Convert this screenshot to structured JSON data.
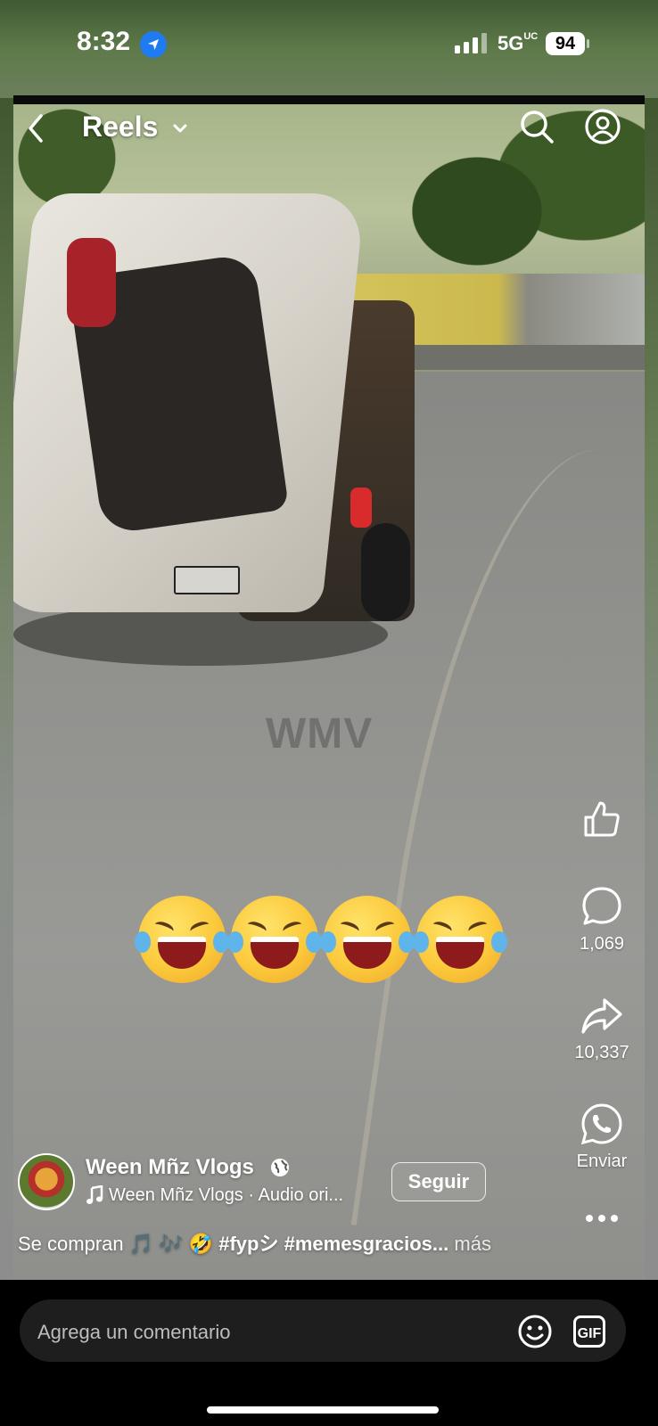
{
  "status_bar": {
    "time": "8:32",
    "network": "5G",
    "network_suffix": "UC",
    "battery": "94",
    "icons": [
      "location-arrow-icon",
      "signal-bars-icon",
      "battery-icon"
    ]
  },
  "header": {
    "title": "Reels",
    "icons": [
      "chevron-left-icon",
      "chevron-down-icon",
      "search-icon",
      "profile-icon"
    ]
  },
  "video": {
    "watermark": "WMV",
    "emoji_overlay": "🤣🤣🤣🤣"
  },
  "actions": {
    "like_icon": "thumbs-up-icon",
    "comment_count": "1,069",
    "share_count": "10,337",
    "send_label": "Enviar",
    "more_icon": "ellipsis-icon"
  },
  "creator": {
    "name": "Ween Mñz Vlogs",
    "audio": "Ween Mñz Vlogs · Audio ori...",
    "follow_label": "Seguir"
  },
  "caption": {
    "text": "Se compran 🎵 🎶 🤣 ",
    "tags": "#fypシ #memesgracios...",
    "more": " más"
  },
  "comment_bar": {
    "placeholder": "Agrega un comentario",
    "gif_label": "GIF"
  },
  "colors": {
    "accent_blue": "#1f7bf2",
    "background": "#000000",
    "field_bg": "#1e1e1e"
  }
}
